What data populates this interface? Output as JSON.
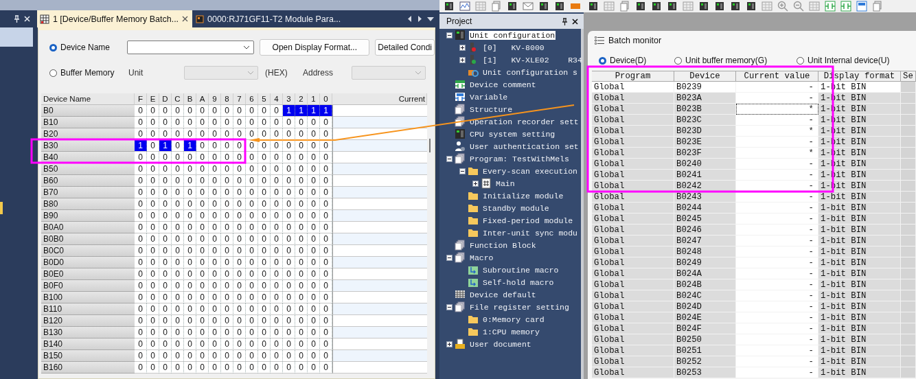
{
  "document_tabs": [
    {
      "title": "1 [Device/Buffer Memory Batch...",
      "selected": true
    },
    {
      "title": "0000:RJ71GF11-T2 Module Para...",
      "selected": false
    }
  ],
  "device_panel": {
    "radios": [
      {
        "label": "Device Name",
        "selected": true
      },
      {
        "label": "Buffer Memory",
        "selected": false
      }
    ],
    "buttons": [
      "Open Display Format...",
      "Detailed Condi"
    ],
    "unit_label": "Unit",
    "hex_label": "(HEX)",
    "address_label": "Address"
  },
  "bit_grid": {
    "name_column": "Device Name",
    "bit_columns": [
      "F",
      "E",
      "D",
      "C",
      "B",
      "A",
      "9",
      "8",
      "7",
      "6",
      "5",
      "4",
      "3",
      "2",
      "1",
      "0"
    ],
    "value_column": "Current",
    "rows": [
      {
        "device": "B0",
        "bits": [
          "0",
          "0",
          "0",
          "0",
          "0",
          "0",
          "0",
          "0",
          "0",
          "0",
          "0",
          "0",
          "1",
          "1",
          "1",
          "1"
        ],
        "on": [
          false,
          false,
          false,
          false,
          false,
          false,
          false,
          false,
          false,
          false,
          false,
          false,
          true,
          true,
          true,
          true
        ]
      },
      {
        "device": "B10",
        "bits": [
          "0",
          "0",
          "0",
          "0",
          "0",
          "0",
          "0",
          "0",
          "0",
          "0",
          "0",
          "0",
          "0",
          "0",
          "0",
          "0"
        ],
        "on": [
          false,
          false,
          false,
          false,
          false,
          false,
          false,
          false,
          false,
          false,
          false,
          false,
          false,
          false,
          false,
          false
        ]
      },
      {
        "device": "B20",
        "bits": [
          "0",
          "0",
          "0",
          "0",
          "0",
          "0",
          "0",
          "0",
          "0",
          "0",
          "0",
          "0",
          "0",
          "0",
          "0",
          "0"
        ],
        "on": [
          false,
          false,
          false,
          false,
          false,
          false,
          false,
          false,
          false,
          false,
          false,
          false,
          false,
          false,
          false,
          false
        ]
      },
      {
        "device": "B30",
        "bits": [
          "1",
          "0",
          "1",
          "0",
          "1",
          "0",
          "0",
          "0",
          "0",
          "0",
          "0",
          "0",
          "0",
          "0",
          "0",
          "0"
        ],
        "on": [
          true,
          false,
          true,
          false,
          true,
          false,
          false,
          false,
          false,
          false,
          false,
          false,
          false,
          false,
          false,
          false
        ]
      },
      {
        "device": "B40",
        "bits": [
          "0",
          "0",
          "0",
          "0",
          "0",
          "0",
          "0",
          "0",
          "0",
          "0",
          "0",
          "0",
          "0",
          "0",
          "0",
          "0"
        ],
        "on": [
          false,
          false,
          false,
          false,
          false,
          false,
          false,
          false,
          false,
          false,
          false,
          false,
          false,
          false,
          false,
          false
        ]
      },
      {
        "device": "B50",
        "bits": [
          "0",
          "0",
          "0",
          "0",
          "0",
          "0",
          "0",
          "0",
          "0",
          "0",
          "0",
          "0",
          "0",
          "0",
          "0",
          "0"
        ],
        "on": [
          false,
          false,
          false,
          false,
          false,
          false,
          false,
          false,
          false,
          false,
          false,
          false,
          false,
          false,
          false,
          false
        ]
      },
      {
        "device": "B60",
        "bits": [
          "0",
          "0",
          "0",
          "0",
          "0",
          "0",
          "0",
          "0",
          "0",
          "0",
          "0",
          "0",
          "0",
          "0",
          "0",
          "0"
        ],
        "on": [
          false,
          false,
          false,
          false,
          false,
          false,
          false,
          false,
          false,
          false,
          false,
          false,
          false,
          false,
          false,
          false
        ]
      },
      {
        "device": "B70",
        "bits": [
          "0",
          "0",
          "0",
          "0",
          "0",
          "0",
          "0",
          "0",
          "0",
          "0",
          "0",
          "0",
          "0",
          "0",
          "0",
          "0"
        ],
        "on": [
          false,
          false,
          false,
          false,
          false,
          false,
          false,
          false,
          false,
          false,
          false,
          false,
          false,
          false,
          false,
          false
        ]
      },
      {
        "device": "B80",
        "bits": [
          "0",
          "0",
          "0",
          "0",
          "0",
          "0",
          "0",
          "0",
          "0",
          "0",
          "0",
          "0",
          "0",
          "0",
          "0",
          "0"
        ],
        "on": [
          false,
          false,
          false,
          false,
          false,
          false,
          false,
          false,
          false,
          false,
          false,
          false,
          false,
          false,
          false,
          false
        ]
      },
      {
        "device": "B90",
        "bits": [
          "0",
          "0",
          "0",
          "0",
          "0",
          "0",
          "0",
          "0",
          "0",
          "0",
          "0",
          "0",
          "0",
          "0",
          "0",
          "0"
        ],
        "on": [
          false,
          false,
          false,
          false,
          false,
          false,
          false,
          false,
          false,
          false,
          false,
          false,
          false,
          false,
          false,
          false
        ]
      },
      {
        "device": "B0A0",
        "bits": [
          "0",
          "0",
          "0",
          "0",
          "0",
          "0",
          "0",
          "0",
          "0",
          "0",
          "0",
          "0",
          "0",
          "0",
          "0",
          "0"
        ],
        "on": [
          false,
          false,
          false,
          false,
          false,
          false,
          false,
          false,
          false,
          false,
          false,
          false,
          false,
          false,
          false,
          false
        ]
      },
      {
        "device": "B0B0",
        "bits": [
          "0",
          "0",
          "0",
          "0",
          "0",
          "0",
          "0",
          "0",
          "0",
          "0",
          "0",
          "0",
          "0",
          "0",
          "0",
          "0"
        ],
        "on": [
          false,
          false,
          false,
          false,
          false,
          false,
          false,
          false,
          false,
          false,
          false,
          false,
          false,
          false,
          false,
          false
        ]
      },
      {
        "device": "B0C0",
        "bits": [
          "0",
          "0",
          "0",
          "0",
          "0",
          "0",
          "0",
          "0",
          "0",
          "0",
          "0",
          "0",
          "0",
          "0",
          "0",
          "0"
        ],
        "on": [
          false,
          false,
          false,
          false,
          false,
          false,
          false,
          false,
          false,
          false,
          false,
          false,
          false,
          false,
          false,
          false
        ]
      },
      {
        "device": "B0D0",
        "bits": [
          "0",
          "0",
          "0",
          "0",
          "0",
          "0",
          "0",
          "0",
          "0",
          "0",
          "0",
          "0",
          "0",
          "0",
          "0",
          "0"
        ],
        "on": [
          false,
          false,
          false,
          false,
          false,
          false,
          false,
          false,
          false,
          false,
          false,
          false,
          false,
          false,
          false,
          false
        ]
      },
      {
        "device": "B0E0",
        "bits": [
          "0",
          "0",
          "0",
          "0",
          "0",
          "0",
          "0",
          "0",
          "0",
          "0",
          "0",
          "0",
          "0",
          "0",
          "0",
          "0"
        ],
        "on": [
          false,
          false,
          false,
          false,
          false,
          false,
          false,
          false,
          false,
          false,
          false,
          false,
          false,
          false,
          false,
          false
        ]
      },
      {
        "device": "B0F0",
        "bits": [
          "0",
          "0",
          "0",
          "0",
          "0",
          "0",
          "0",
          "0",
          "0",
          "0",
          "0",
          "0",
          "0",
          "0",
          "0",
          "0"
        ],
        "on": [
          false,
          false,
          false,
          false,
          false,
          false,
          false,
          false,
          false,
          false,
          false,
          false,
          false,
          false,
          false,
          false
        ]
      },
      {
        "device": "B100",
        "bits": [
          "0",
          "0",
          "0",
          "0",
          "0",
          "0",
          "0",
          "0",
          "0",
          "0",
          "0",
          "0",
          "0",
          "0",
          "0",
          "0"
        ],
        "on": [
          false,
          false,
          false,
          false,
          false,
          false,
          false,
          false,
          false,
          false,
          false,
          false,
          false,
          false,
          false,
          false
        ]
      },
      {
        "device": "B110",
        "bits": [
          "0",
          "0",
          "0",
          "0",
          "0",
          "0",
          "0",
          "0",
          "0",
          "0",
          "0",
          "0",
          "0",
          "0",
          "0",
          "0"
        ],
        "on": [
          false,
          false,
          false,
          false,
          false,
          false,
          false,
          false,
          false,
          false,
          false,
          false,
          false,
          false,
          false,
          false
        ]
      },
      {
        "device": "B120",
        "bits": [
          "0",
          "0",
          "0",
          "0",
          "0",
          "0",
          "0",
          "0",
          "0",
          "0",
          "0",
          "0",
          "0",
          "0",
          "0",
          "0"
        ],
        "on": [
          false,
          false,
          false,
          false,
          false,
          false,
          false,
          false,
          false,
          false,
          false,
          false,
          false,
          false,
          false,
          false
        ]
      },
      {
        "device": "B130",
        "bits": [
          "0",
          "0",
          "0",
          "0",
          "0",
          "0",
          "0",
          "0",
          "0",
          "0",
          "0",
          "0",
          "0",
          "0",
          "0",
          "0"
        ],
        "on": [
          false,
          false,
          false,
          false,
          false,
          false,
          false,
          false,
          false,
          false,
          false,
          false,
          false,
          false,
          false,
          false
        ]
      },
      {
        "device": "B140",
        "bits": [
          "0",
          "0",
          "0",
          "0",
          "0",
          "0",
          "0",
          "0",
          "0",
          "0",
          "0",
          "0",
          "0",
          "0",
          "0",
          "0"
        ],
        "on": [
          false,
          false,
          false,
          false,
          false,
          false,
          false,
          false,
          false,
          false,
          false,
          false,
          false,
          false,
          false,
          false
        ]
      },
      {
        "device": "B150",
        "bits": [
          "0",
          "0",
          "0",
          "0",
          "0",
          "0",
          "0",
          "0",
          "0",
          "0",
          "0",
          "0",
          "0",
          "0",
          "0",
          "0"
        ],
        "on": [
          false,
          false,
          false,
          false,
          false,
          false,
          false,
          false,
          false,
          false,
          false,
          false,
          false,
          false,
          false,
          false
        ]
      },
      {
        "device": "B160",
        "bits": [
          "0",
          "0",
          "0",
          "0",
          "0",
          "0",
          "0",
          "0",
          "0",
          "0",
          "0",
          "0",
          "0",
          "0",
          "0",
          "0"
        ],
        "on": [
          false,
          false,
          false,
          false,
          false,
          false,
          false,
          false,
          false,
          false,
          false,
          false,
          false,
          false,
          false,
          false
        ]
      }
    ]
  },
  "project": {
    "title": "Project",
    "tree": [
      {
        "label": "Unit configuration",
        "kind": "rack",
        "expanded": true,
        "selected": true,
        "children": [
          {
            "label": "[0]   KV-8000",
            "kind": "module",
            "color": "#e0202a",
            "expanded": false,
            "selected": false
          },
          {
            "label": "[1]   KV-XLE02    R34",
            "kind": "module",
            "color": "#2aa84a",
            "expanded": false,
            "selected": false
          },
          {
            "label": "Unit configuration s",
            "kind": "config",
            "selected": false
          }
        ]
      },
      {
        "label": "Device comment",
        "kind": "contact",
        "selected": false
      },
      {
        "label": "Variable",
        "kind": "variable",
        "selected": false
      },
      {
        "label": "Structure",
        "kind": "pages",
        "selected": false
      },
      {
        "label": "Operation recorder sett",
        "kind": "pages",
        "selected": false
      },
      {
        "label": "CPU system setting",
        "kind": "rack",
        "selected": false
      },
      {
        "label": "User authentication set",
        "kind": "user",
        "selected": false
      },
      {
        "label": "Program: TestWithMels",
        "kind": "pages",
        "expanded": true,
        "selected": false,
        "children": [
          {
            "label": "Every-scan execution",
            "kind": "folder",
            "expanded": true,
            "selected": false,
            "children": [
              {
                "label": "Main",
                "kind": "ladder",
                "expanded": false,
                "selected": false
              }
            ]
          },
          {
            "label": "Initialize module",
            "kind": "folder",
            "selected": false
          },
          {
            "label": "Standby module",
            "kind": "folder",
            "selected": false
          },
          {
            "label": "Fixed-period module",
            "kind": "folder",
            "selected": false
          },
          {
            "label": "Inter-unit sync modu",
            "kind": "folder",
            "selected": false
          }
        ]
      },
      {
        "label": "Function Block",
        "kind": "pages",
        "selected": false
      },
      {
        "label": "Macro",
        "kind": "pages",
        "expanded": true,
        "selected": false,
        "children": [
          {
            "label": "Subroutine macro",
            "kind": "arrow",
            "selected": false
          },
          {
            "label": "Self-hold macro",
            "kind": "arrow",
            "selected": false
          }
        ]
      },
      {
        "label": "Device default",
        "kind": "grid",
        "selected": false
      },
      {
        "label": "File register setting",
        "kind": "pages",
        "expanded": true,
        "selected": false,
        "children": [
          {
            "label": "0:Memory card",
            "kind": "folder",
            "selected": false
          },
          {
            "label": "1:CPU memory",
            "kind": "folder",
            "selected": false
          }
        ]
      },
      {
        "label": "User document",
        "kind": "docfolder",
        "expanded": false,
        "selected": false
      }
    ]
  },
  "batch_monitor": {
    "title": "Batch monitor",
    "radios": [
      {
        "label": "Device(D)",
        "selected": true
      },
      {
        "label": "Unit buffer memory(G)",
        "selected": false
      },
      {
        "label": "Unit Internal device(U)",
        "selected": false
      }
    ],
    "columns": [
      "Program",
      "Device",
      "Current value",
      "Display format",
      "Se"
    ],
    "rows": [
      {
        "program": "Global",
        "device": "B0239",
        "value": "-",
        "format": "1-bit BIN",
        "selected": true,
        "focused": false
      },
      {
        "program": "Global",
        "device": "B023A",
        "value": "-",
        "format": "1-bit BIN",
        "selected": false,
        "focused": false
      },
      {
        "program": "Global",
        "device": "B023B",
        "value": "*",
        "format": "1-bit BIN",
        "selected": false,
        "focused": true
      },
      {
        "program": "Global",
        "device": "B023C",
        "value": "-",
        "format": "1-bit BIN",
        "selected": false,
        "focused": false
      },
      {
        "program": "Global",
        "device": "B023D",
        "value": "*",
        "format": "1-bit BIN",
        "selected": false,
        "focused": false
      },
      {
        "program": "Global",
        "device": "B023E",
        "value": "-",
        "format": "1-bit BIN",
        "selected": false,
        "focused": false
      },
      {
        "program": "Global",
        "device": "B023F",
        "value": "*",
        "format": "1-bit BIN",
        "selected": false,
        "focused": false
      },
      {
        "program": "Global",
        "device": "B0240",
        "value": "-",
        "format": "1-bit BIN",
        "selected": false,
        "focused": false
      },
      {
        "program": "Global",
        "device": "B0241",
        "value": "-",
        "format": "1-bit BIN",
        "selected": false,
        "focused": false
      },
      {
        "program": "Global",
        "device": "B0242",
        "value": "-",
        "format": "1-bit BIN",
        "selected": false,
        "focused": false
      },
      {
        "program": "Global",
        "device": "B0243",
        "value": "-",
        "format": "1-bit BIN",
        "selected": false,
        "focused": false
      },
      {
        "program": "Global",
        "device": "B0244",
        "value": "-",
        "format": "1-bit BIN",
        "selected": false,
        "focused": false
      },
      {
        "program": "Global",
        "device": "B0245",
        "value": "-",
        "format": "1-bit BIN",
        "selected": false,
        "focused": false
      },
      {
        "program": "Global",
        "device": "B0246",
        "value": "-",
        "format": "1-bit BIN",
        "selected": false,
        "focused": false
      },
      {
        "program": "Global",
        "device": "B0247",
        "value": "-",
        "format": "1-bit BIN",
        "selected": false,
        "focused": false
      },
      {
        "program": "Global",
        "device": "B0248",
        "value": "-",
        "format": "1-bit BIN",
        "selected": false,
        "focused": false
      },
      {
        "program": "Global",
        "device": "B0249",
        "value": "-",
        "format": "1-bit BIN",
        "selected": false,
        "focused": false
      },
      {
        "program": "Global",
        "device": "B024A",
        "value": "-",
        "format": "1-bit BIN",
        "selected": false,
        "focused": false
      },
      {
        "program": "Global",
        "device": "B024B",
        "value": "-",
        "format": "1-bit BIN",
        "selected": false,
        "focused": false
      },
      {
        "program": "Global",
        "device": "B024C",
        "value": "-",
        "format": "1-bit BIN",
        "selected": false,
        "focused": false
      },
      {
        "program": "Global",
        "device": "B024D",
        "value": "-",
        "format": "1-bit BIN",
        "selected": false,
        "focused": false
      },
      {
        "program": "Global",
        "device": "B024E",
        "value": "-",
        "format": "1-bit BIN",
        "selected": false,
        "focused": false
      },
      {
        "program": "Global",
        "device": "B024F",
        "value": "-",
        "format": "1-bit BIN",
        "selected": false,
        "focused": false
      },
      {
        "program": "Global",
        "device": "B0250",
        "value": "-",
        "format": "1-bit BIN",
        "selected": false,
        "focused": false
      },
      {
        "program": "Global",
        "device": "B0251",
        "value": "-",
        "format": "1-bit BIN",
        "selected": false,
        "focused": false
      },
      {
        "program": "Global",
        "device": "B0252",
        "value": "-",
        "format": "1-bit BIN",
        "selected": false,
        "focused": false
      },
      {
        "program": "Global",
        "device": "B0253",
        "value": "-",
        "format": "1-bit BIN",
        "selected": false,
        "focused": false
      }
    ]
  }
}
